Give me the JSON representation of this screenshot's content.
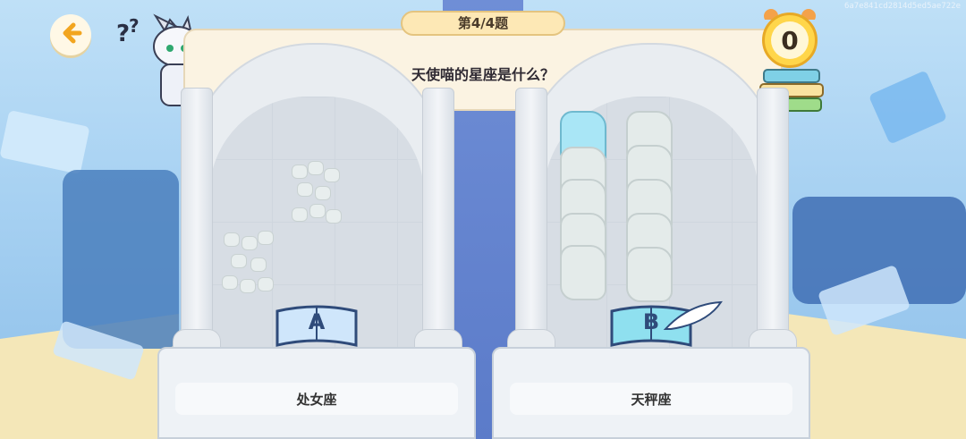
{
  "header": {
    "question_counter": "第4/4题",
    "question_text": "天使喵的星座是什么？",
    "timer_value": "0",
    "id_string": "6a7e841cd2814d5ed5ae722e"
  },
  "options": [
    {
      "letter": "A",
      "answer": "处女座"
    },
    {
      "letter": "B",
      "answer": "天秤座"
    }
  ],
  "icons": {
    "back": "back-arrow-icon",
    "timer": "alarm-clock-icon",
    "books": "book-stack-icon"
  },
  "colors": {
    "accent_gold": "#ffd64a",
    "book_blue": "#cfe6fb",
    "book_teal": "#8fe0ef"
  }
}
